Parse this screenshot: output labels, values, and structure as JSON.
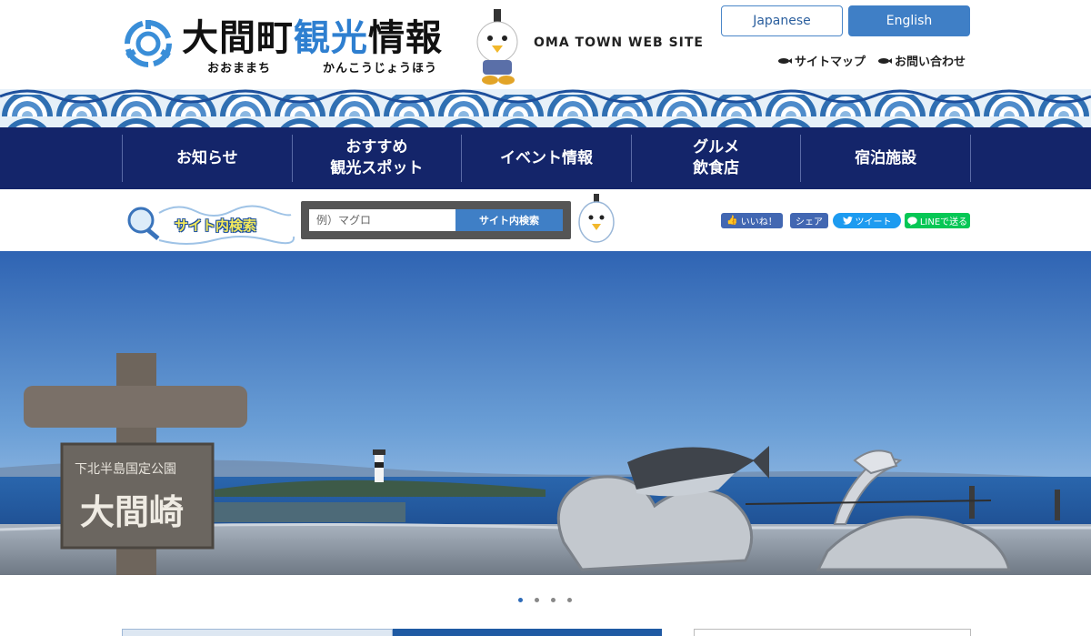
{
  "header": {
    "title_part1": "大間町",
    "title_part2": "観光",
    "title_part3": "情報",
    "ruby_town": "おおままち",
    "ruby_info": "かんこうじょうほう",
    "site_name_en": "OMA TOWN WEB SITE",
    "lang_japanese": "Japanese",
    "lang_english": "English",
    "sitemap": "サイトマップ",
    "contact": "お問い合わせ"
  },
  "nav": {
    "items": [
      {
        "line1": "お知らせ",
        "line2": ""
      },
      {
        "line1": "おすすめ",
        "line2": "観光スポット"
      },
      {
        "line1": "イベント情報",
        "line2": ""
      },
      {
        "line1": "グルメ",
        "line2": "飲食店"
      },
      {
        "line1": "宿泊施設",
        "line2": ""
      }
    ]
  },
  "search": {
    "badge_label": "サイト内検索",
    "placeholder": "例）マグロ",
    "button_label": "サイト内検索"
  },
  "social": {
    "like": "いいね！",
    "share": "シェア",
    "tweet": "ツイート",
    "line": "LINEで送る"
  },
  "hero": {
    "sign_small": "下北半島国定公園",
    "sign_large": "大間崎"
  },
  "carousel": {
    "dot_count": 4,
    "active_index": 0
  },
  "colors": {
    "nav_bg": "#14256a",
    "accent_blue": "#2e7fd0",
    "button_blue": "#3f7fc6",
    "line_green": "#06c755",
    "facebook_blue": "#4267b2",
    "twitter_blue": "#1d9bf0"
  }
}
